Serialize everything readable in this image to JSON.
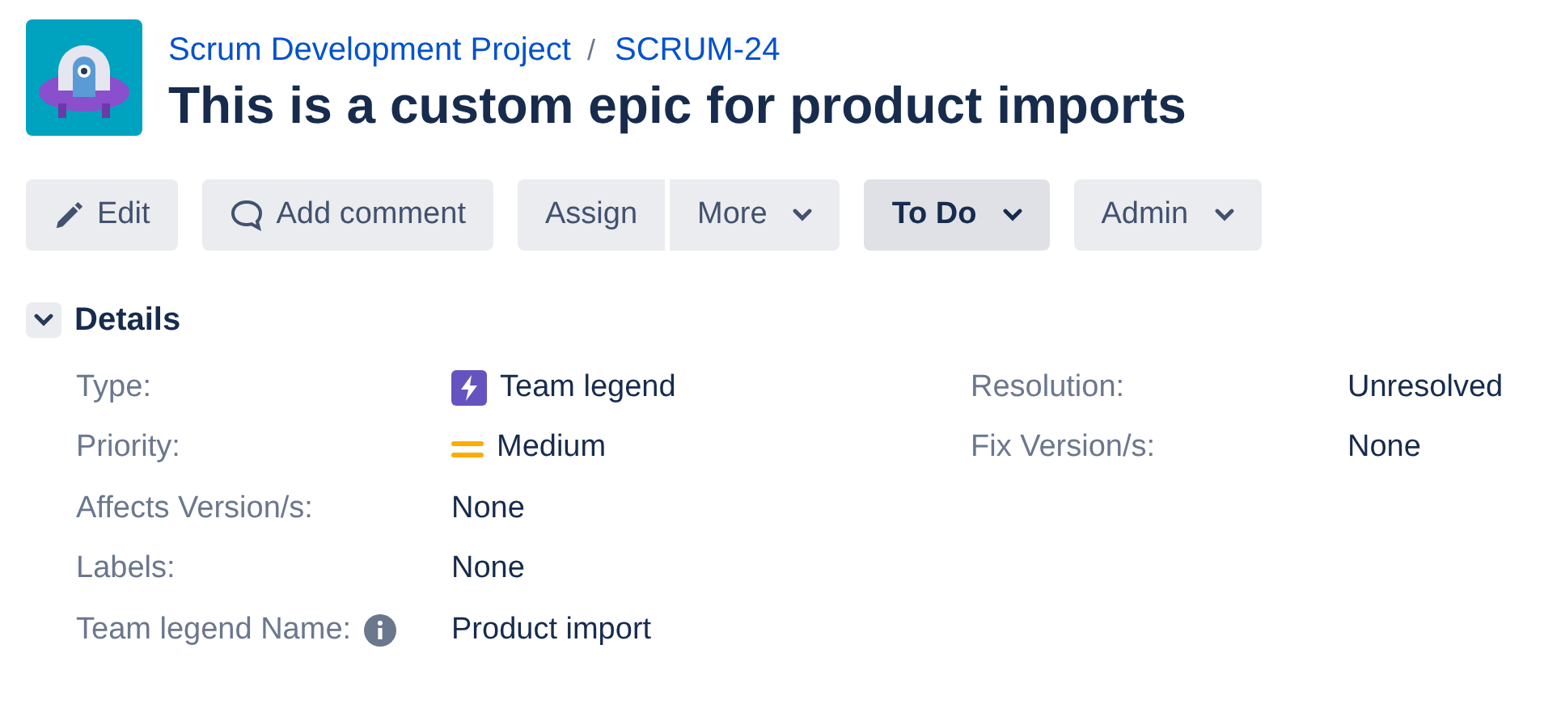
{
  "breadcrumb": [
    {
      "text": "Scrum Development Project"
    },
    {
      "text": "SCRUM-24"
    }
  ],
  "breadcrumb_separator": "/",
  "title": "This is a custom epic for product imports",
  "buttons": [
    {
      "label": "Edit",
      "kind": "edit",
      "dropdown": false,
      "attached": false
    },
    {
      "label": "Add comment",
      "kind": "comment",
      "dropdown": false,
      "attached": false
    },
    {
      "label": "Assign",
      "kind": "plain",
      "dropdown": false,
      "attached": false
    },
    {
      "label": "More",
      "kind": "plain",
      "dropdown": true,
      "attached": true
    },
    {
      "label": "To Do",
      "kind": "status",
      "dropdown": true,
      "attached": false
    },
    {
      "label": "Admin",
      "kind": "plain",
      "dropdown": true,
      "attached": false
    }
  ],
  "details": {
    "title": "Details",
    "expanded": true,
    "left": [
      {
        "label": "Type:",
        "value": "Team legend",
        "kind": "type",
        "info": false
      },
      {
        "label": "Priority:",
        "value": "Medium",
        "kind": "priority",
        "info": false
      },
      {
        "label": "Affects Version/s:",
        "value": "None",
        "kind": "text",
        "info": false
      },
      {
        "label": "Labels:",
        "value": "None",
        "kind": "text",
        "info": false
      },
      {
        "label": "Team legend Name:",
        "value": "Product import",
        "kind": "text",
        "info": true
      }
    ],
    "right": [
      {
        "label": "Resolution:",
        "value": "Unresolved",
        "info": false
      },
      {
        "label": "Fix Version/s:",
        "value": "None",
        "info": false
      }
    ]
  }
}
